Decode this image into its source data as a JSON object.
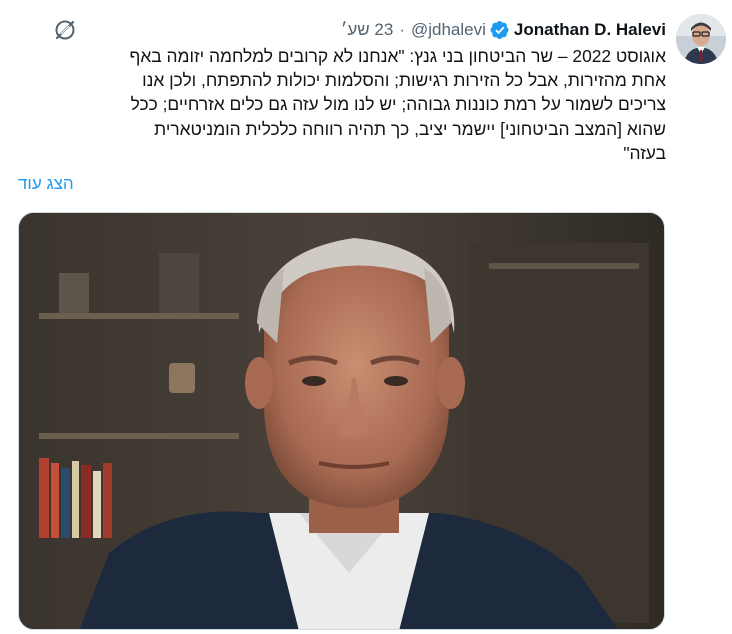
{
  "tweet": {
    "author_name": "Jonathan D. Halevi",
    "handle": "@jdhalevi",
    "separator": "·",
    "timestamp": "23 שע׳",
    "text_lines": [
      "אוגוסט 2022 – שר הביטחון בני גנץ: \"אנחנו לא קרובים למלחמה יזומה באף",
      "אחת מהזירות, אבל כל הזירות  רגישות; והסלמות יכולות להתפתח, ולכן אנו",
      "צריכים לשמור על רמת כוננות גבוהה; יש לנו מול עזה גם כלים אזרחיים; ככל",
      "שהוא [המצב הביטחוני] יישמר יציב, כך תהיה רווחה כלכלית הומניטארית",
      "בעזה\""
    ],
    "show_more": "הצג עוד"
  },
  "icons": {
    "verified": "verified-badge-icon",
    "more": "grok-icon",
    "avatar": "profile-photo"
  },
  "colors": {
    "link": "#1d9bf0",
    "secondary_text": "#536471",
    "verified": "#1d9bf0"
  }
}
